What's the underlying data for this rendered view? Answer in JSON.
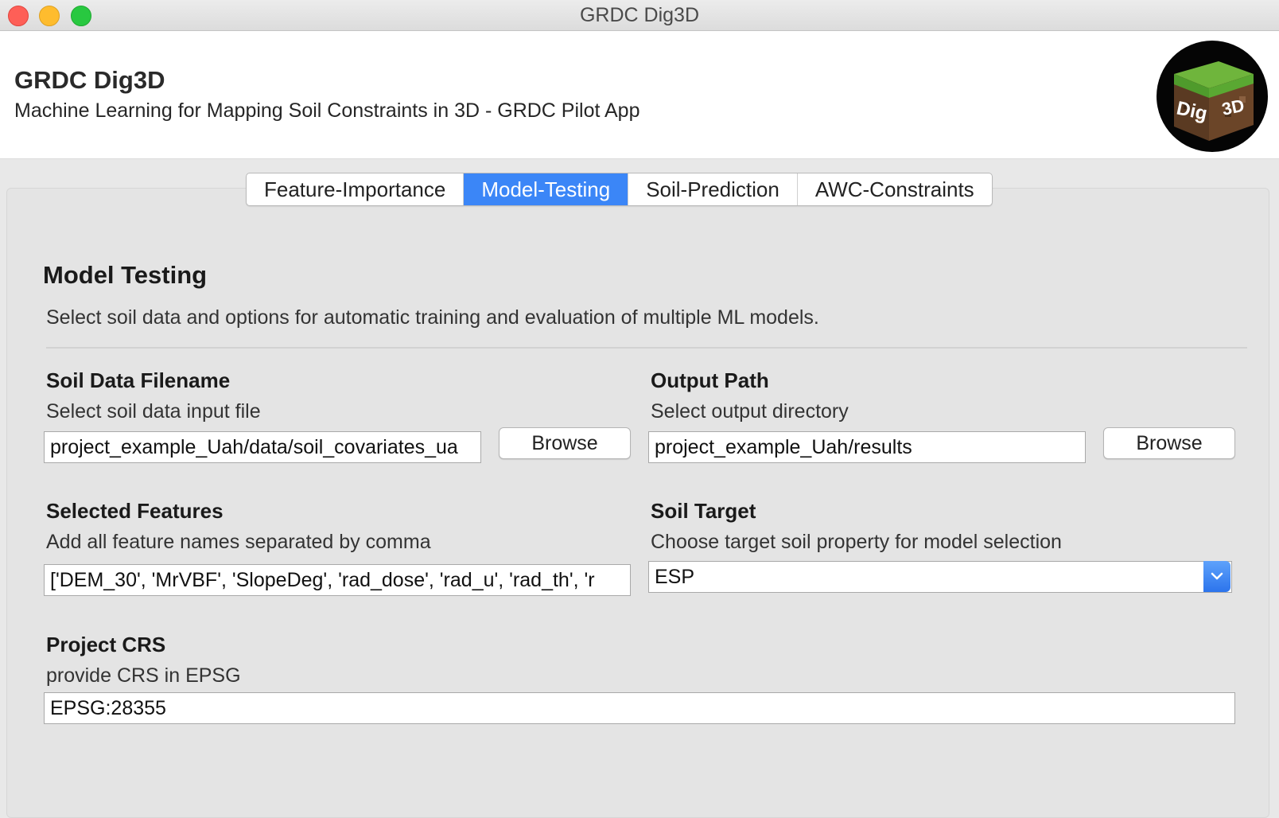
{
  "window": {
    "title": "GRDC Dig3D"
  },
  "header": {
    "app_name": "GRDC Dig3D",
    "subtitle": "Machine Learning for Mapping Soil Constraints in 3D - GRDC Pilot App",
    "logo": {
      "text_left": "Dig",
      "text_right": "3D"
    }
  },
  "tabs": [
    {
      "label": "Feature-Importance",
      "active": false
    },
    {
      "label": "Model-Testing",
      "active": true
    },
    {
      "label": "Soil-Prediction",
      "active": false
    },
    {
      "label": "AWC-Constraints",
      "active": false
    }
  ],
  "main": {
    "title": "Model Testing",
    "description": "Select soil data and options for automatic training and evaluation of multiple ML models.",
    "soil_data": {
      "label": "Soil Data Filename",
      "help": "Select soil data input file",
      "value": "project_example_Uah/data/soil_covariates_ua",
      "button": "Browse"
    },
    "output_path": {
      "label": "Output Path",
      "help": "Select output directory",
      "value": "project_example_Uah/results",
      "button": "Browse"
    },
    "features": {
      "label": "Selected Features",
      "help": "Add all feature names separated by comma",
      "value": "['DEM_30', 'MrVBF', 'SlopeDeg', 'rad_dose', 'rad_u', 'rad_th', 'r"
    },
    "soil_target": {
      "label": "Soil Target",
      "help": "Choose target soil property for model selection",
      "value": "ESP"
    },
    "crs": {
      "label": "Project CRS",
      "help": "provide CRS in EPSG",
      "value": "EPSG:28355"
    }
  },
  "colors": {
    "accent": "#3b86f7",
    "window_bg": "#e8e8e8"
  }
}
